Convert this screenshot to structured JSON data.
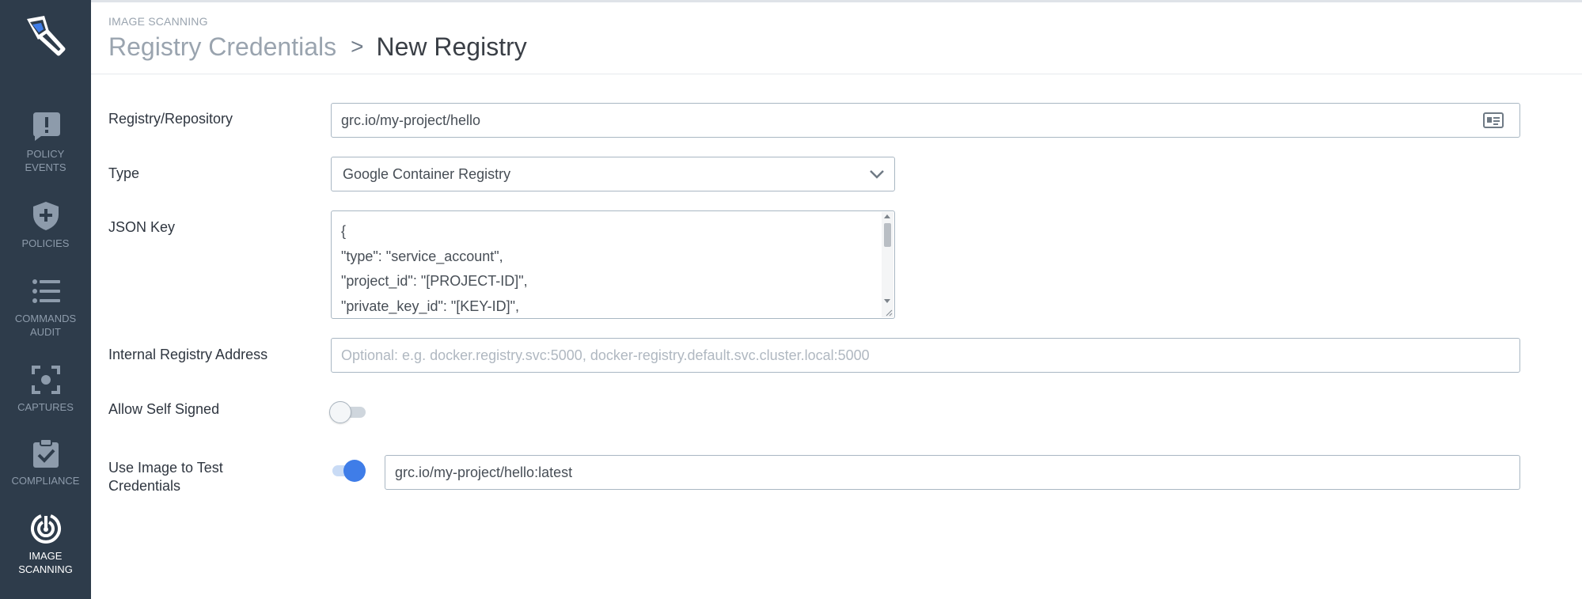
{
  "sidebar": {
    "items": [
      {
        "id": "policy-events",
        "label": "POLICY EVENTS",
        "icon": "alert-bubble-icon",
        "active": false
      },
      {
        "id": "policies",
        "label": "POLICIES",
        "icon": "shield-plus-icon",
        "active": false
      },
      {
        "id": "commands-audit",
        "label": "COMMANDS AUDIT",
        "icon": "list-icon",
        "active": false
      },
      {
        "id": "captures",
        "label": "CAPTURES",
        "icon": "capture-focus-icon",
        "active": false
      },
      {
        "id": "compliance",
        "label": "COMPLIANCE",
        "icon": "clipboard-check-icon",
        "active": false
      },
      {
        "id": "image-scanning",
        "label": "IMAGE SCANNING",
        "icon": "radar-icon",
        "active": true
      }
    ]
  },
  "header": {
    "section": "IMAGE SCANNING",
    "parent": "Registry Credentials",
    "separator": ">",
    "current": "New Registry"
  },
  "form": {
    "registry": {
      "label": "Registry/Repository",
      "value": "grc.io/my-project/hello"
    },
    "type": {
      "label": "Type",
      "value": "Google Container Registry"
    },
    "json_key": {
      "label": "JSON Key",
      "lines": [
        "{",
        "\"type\": \"service_account\",",
        "\"project_id\": \"[PROJECT-ID]\",",
        "\"private_key_id\": \"[KEY-ID]\","
      ]
    },
    "internal_address": {
      "label": "Internal Registry Address",
      "placeholder": "Optional: e.g. docker.registry.svc:5000, docker-registry.default.svc.cluster.local:5000"
    },
    "allow_self_signed": {
      "label": "Allow Self Signed",
      "enabled": false
    },
    "test_image": {
      "label_line1": "Use Image to Test",
      "label_line2": "Credentials",
      "enabled": true,
      "value": "grc.io/my-project/hello:latest"
    }
  },
  "colors": {
    "sidebar_bg": "#2e3c4b",
    "accent": "#3f7de8",
    "border": "#a9b7c3"
  }
}
